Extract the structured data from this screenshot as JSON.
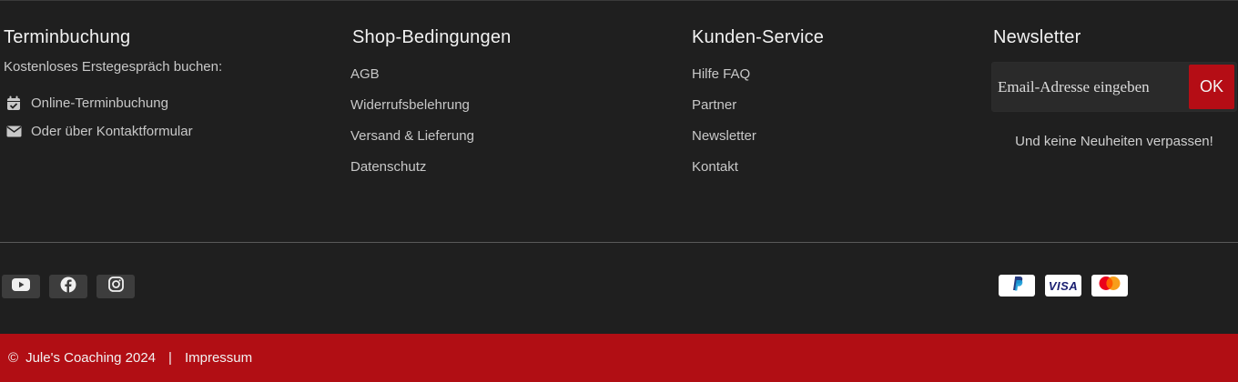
{
  "terminbuchung": {
    "title": "Terminbuchung",
    "intro": "Kostenloses Erstegespräch buchen:",
    "links": [
      {
        "label": "Online-Terminbuchung",
        "icon": "calendar-check-icon"
      },
      {
        "label": "Oder über Kontaktformular",
        "icon": "envelope-icon"
      }
    ]
  },
  "shop": {
    "title": "Shop-Bedingungen",
    "links": [
      "AGB",
      "Widerrufsbelehrung",
      "Versand & Lieferung",
      "Datenschutz"
    ]
  },
  "service": {
    "title": "Kunden-Service",
    "links": [
      "Hilfe FAQ",
      "Partner",
      "Newsletter",
      "Kontakt"
    ]
  },
  "newsletter": {
    "title": "Newsletter",
    "placeholder": "Email-Adresse eingeben",
    "button": "OK",
    "note": "Und keine Neuheiten verpassen!"
  },
  "social": [
    "youtube-icon",
    "facebook-icon",
    "instagram-icon"
  ],
  "payments": [
    {
      "name": "paypal",
      "label": "P"
    },
    {
      "name": "visa",
      "label": "VISA"
    },
    {
      "name": "mastercard"
    }
  ],
  "footer": {
    "copyright_symbol": "©",
    "copyright": "Jule's Coaching 2024",
    "separator": "|",
    "impressum": "Impressum"
  },
  "colors": {
    "background": "#1f1f1f",
    "accent_red": "#b10e14",
    "text": "#c8c8c8"
  }
}
